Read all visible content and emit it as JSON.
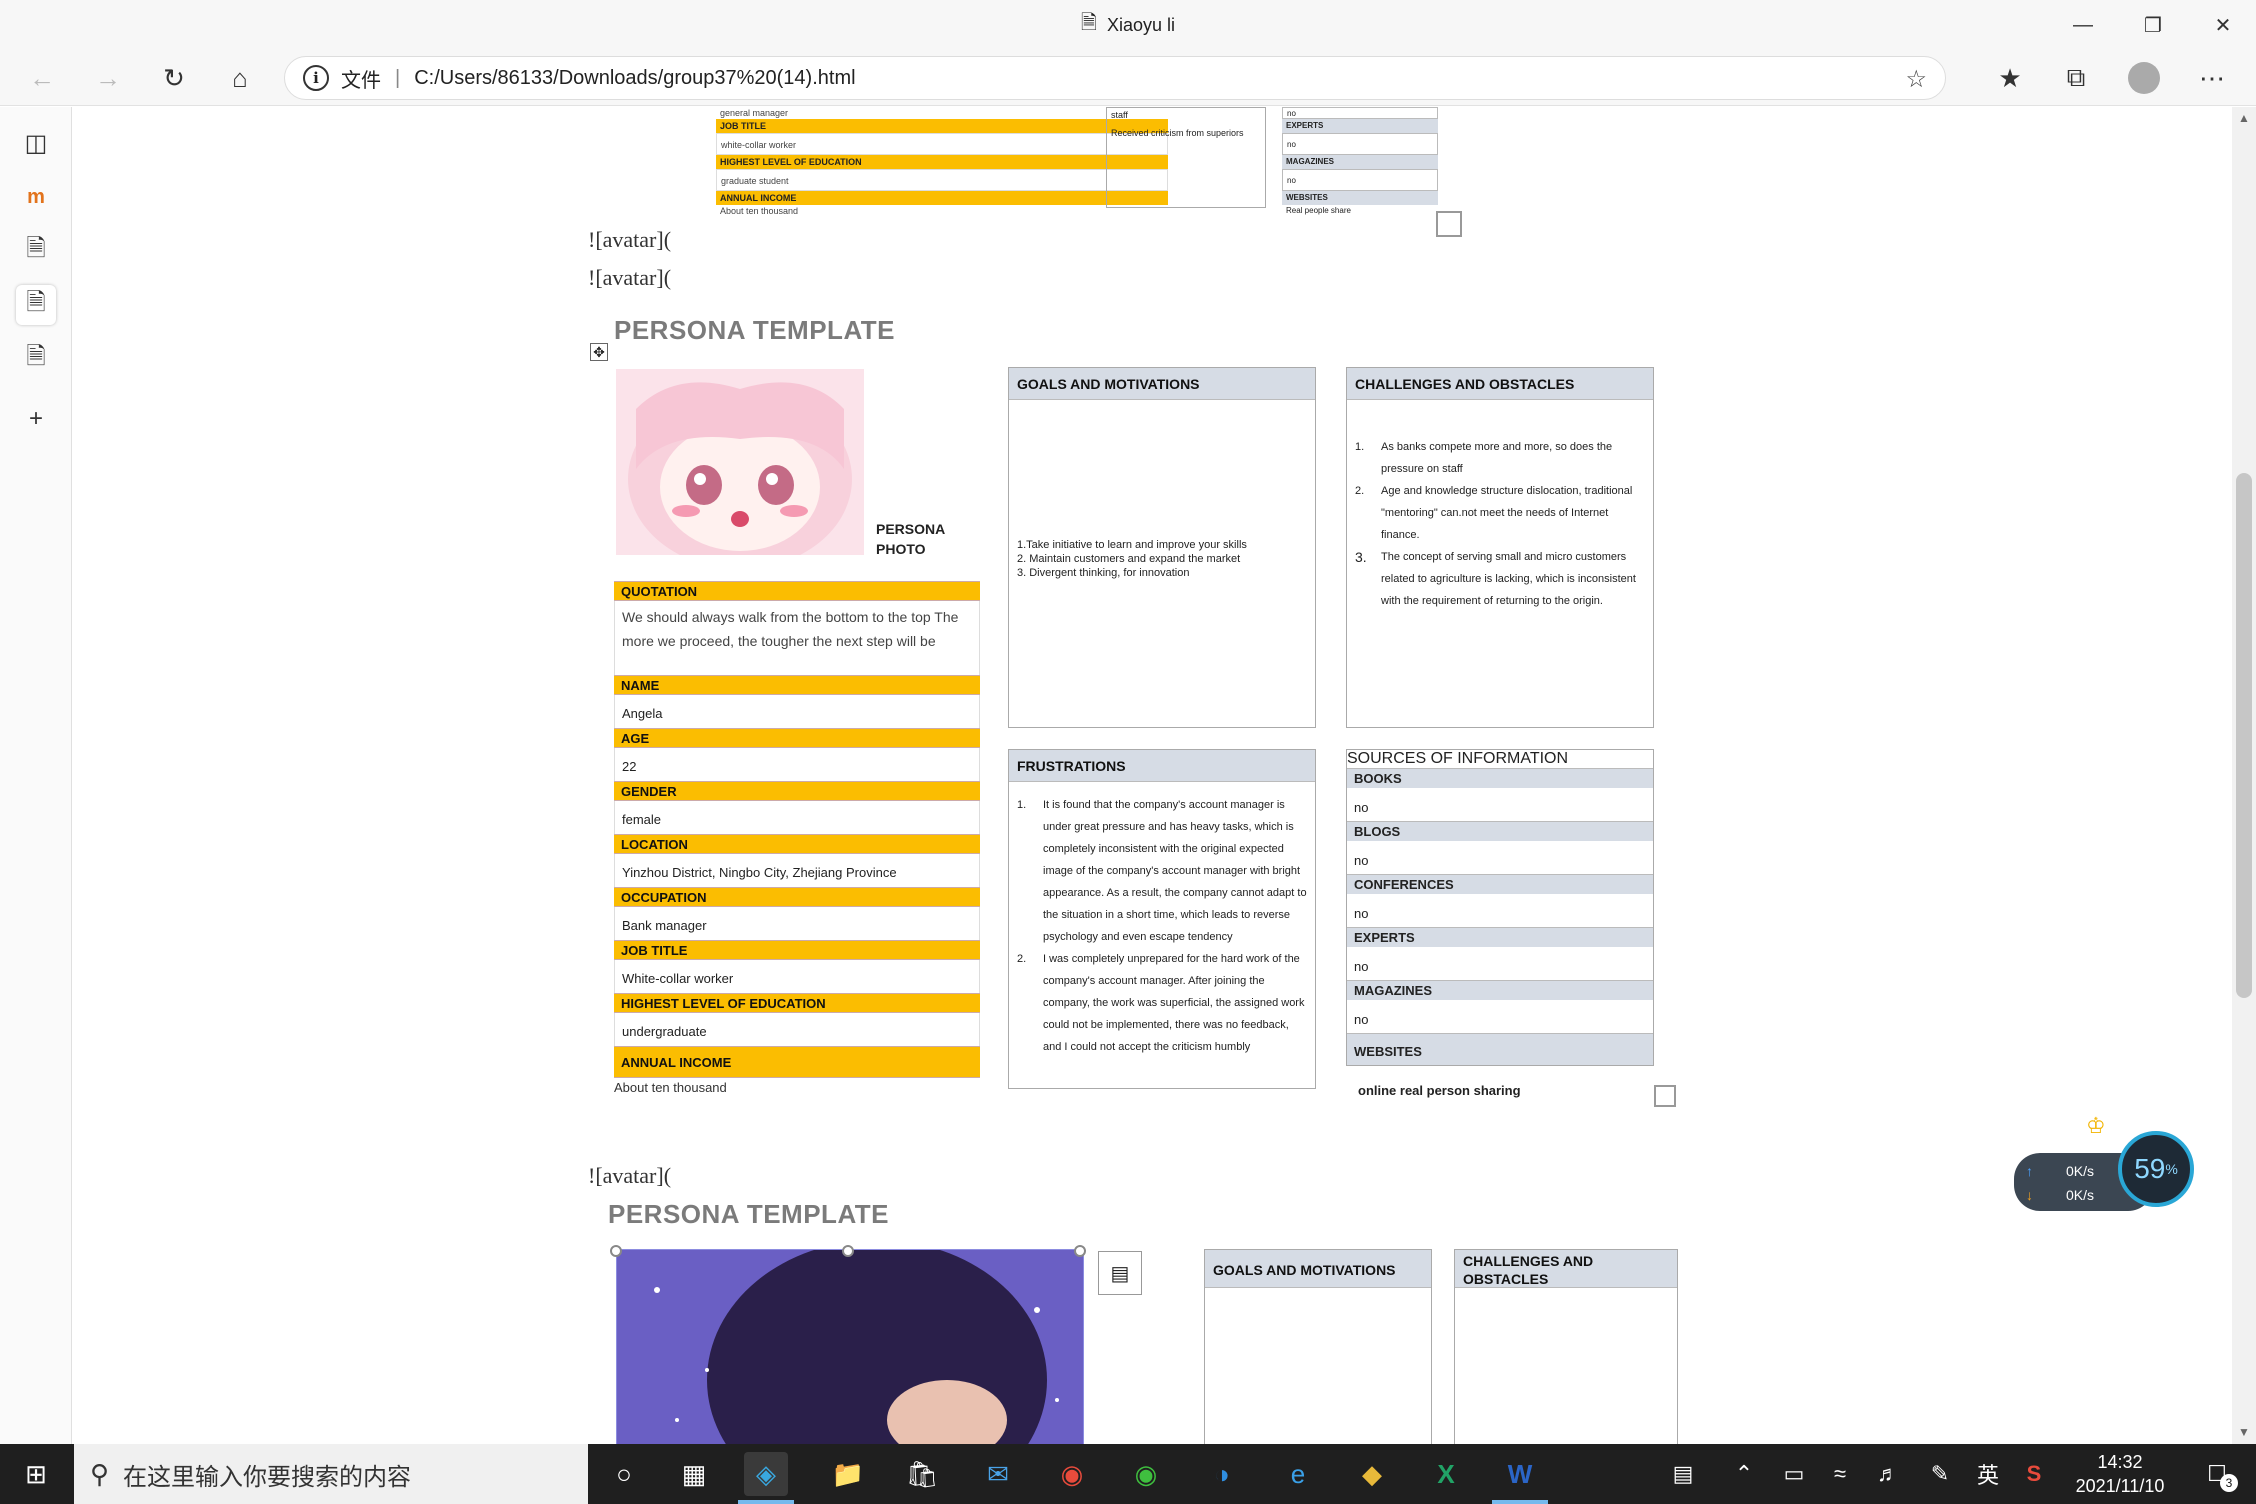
{
  "window": {
    "title": "Xiaoyu li"
  },
  "address": {
    "scheme_label": "文件",
    "url": "C:/Users/86133/Downloads/group37%20(14).html"
  },
  "markdown_lines": {
    "l1": "![avatar](",
    "l2": "![avatar](",
    "l3": "![avatar]("
  },
  "top_partial": {
    "left_rows": [
      "general manager",
      "JOB TITLE",
      "white-collar worker",
      "HIGHEST LEVEL OF EDUCATION",
      "graduate student",
      "ANNUAL INCOME",
      "About ten thousand"
    ],
    "mid_lines": [
      "staff",
      "Received criticism from superiors"
    ],
    "right_rows": [
      "no",
      "EXPERTS",
      "no",
      "MAGAZINES",
      "no",
      "WEBSITES",
      "Real people share"
    ]
  },
  "persona1": {
    "title": "PERSONA TEMPLATE",
    "photo_label_1": "PERSONA",
    "photo_label_2": "PHOTO",
    "fields": [
      {
        "label": "QUOTATION",
        "value": "We should always walk from the bottom to the top The more we proceed, the tougher the next step will be"
      },
      {
        "label": "NAME",
        "value": "Angela"
      },
      {
        "label": "AGE",
        "value": "22"
      },
      {
        "label": "GENDER",
        "value": "female"
      },
      {
        "label": "LOCATION",
        "value": "Yinzhou District, Ningbo City, Zhejiang Province"
      },
      {
        "label": "OCCUPATION",
        "value": "Bank manager"
      },
      {
        "label": "JOB TITLE",
        "value": "White-collar worker"
      },
      {
        "label": "HIGHEST LEVEL OF EDUCATION",
        "value": "undergraduate"
      },
      {
        "label": "ANNUAL INCOME",
        "value": "About  ten thousand"
      }
    ],
    "goals": {
      "title": "GOALS AND MOTIVATIONS",
      "items": [
        "1.Take initiative to learn and improve your skills",
        "2. Maintain customers and expand the market",
        "3. Divergent thinking, for innovation"
      ]
    },
    "challenges": {
      "title": "CHALLENGES AND OBSTACLES",
      "items": [
        {
          "n": "1.",
          "t": "As banks compete more and more, so does the pressure on staff"
        },
        {
          "n": "2.",
          "t": "Age and knowledge structure dislocation, traditional \"mentoring\" can.not meet the needs of Internet finance."
        },
        {
          "n": "3.",
          "t": "The concept of serving small and micro customers related to agriculture is lacking, which is inconsistent with the requirement of returning to the origin."
        }
      ]
    },
    "frustrations": {
      "title": "FRUSTRATIONS",
      "items": [
        {
          "n": "1.",
          "t": "It is found that the company's account manager is under great pressure and has heavy tasks, which is completely inconsistent with the original expected image of the company's account manager with bright appearance. As a result, the company cannot adapt to the situation in a short time, which leads to reverse psychology and even escape tendency"
        },
        {
          "n": "2.",
          "t": "I was completely unprepared for the hard work of the company's account manager. After joining the company, the work was superficial, the assigned work could not be implemented, there was no feedback, and I could not accept the criticism humbly"
        }
      ]
    },
    "sources": {
      "title": "SOURCES OF INFORMATION",
      "rows": [
        {
          "label": "BOOKS",
          "value": "no"
        },
        {
          "label": "BLOGS",
          "value": "no"
        },
        {
          "label": "CONFERENCES",
          "value": "no"
        },
        {
          "label": "EXPERTS",
          "value": "no"
        },
        {
          "label": "MAGAZINES",
          "value": "no"
        },
        {
          "label": "WEBSITES",
          "value": "online real person sharing"
        }
      ]
    }
  },
  "persona2": {
    "title": "PERSONA TEMPLATE",
    "goals_title": "GOALS AND MOTIVATIONS",
    "challenges_title_1": "CHALLENGES AND",
    "challenges_title_2": "OBSTACLES"
  },
  "network": {
    "up": "0K/s",
    "down": "0K/s",
    "percent": "59",
    "percent_sign": "%"
  },
  "taskbar": {
    "search_placeholder": "在这里输入你要搜索的内容",
    "ime": "英",
    "time": "14:32",
    "date": "2021/11/10",
    "notif_count": "3"
  },
  "colors": {
    "accent_yellow": "#fbbd01",
    "header_blue": "#d6dce5"
  }
}
